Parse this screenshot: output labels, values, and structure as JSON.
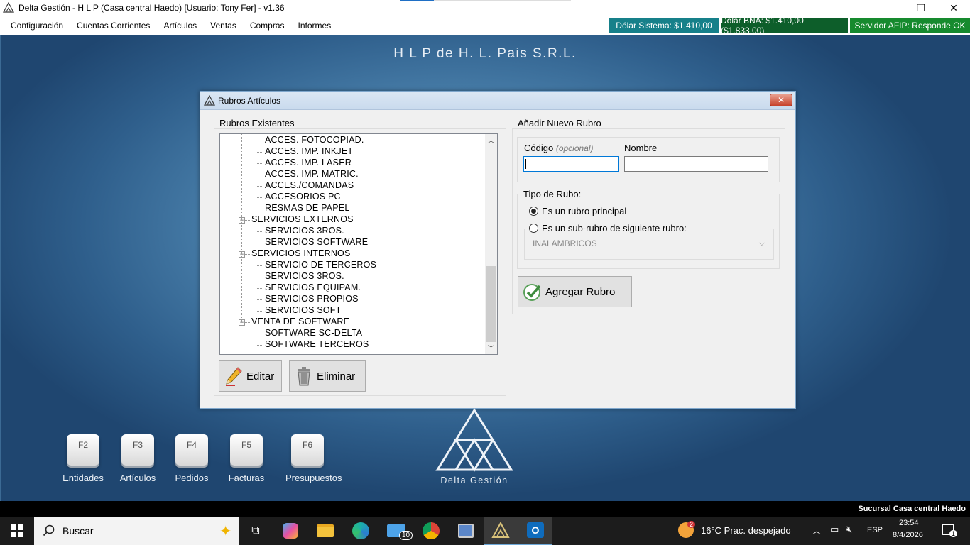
{
  "window": {
    "title": "Delta Gestión - H L P (Casa central Haedo) [Usuario: Tony Fer] - v1.36",
    "minimize": "—",
    "restore": "❐",
    "close": "✕"
  },
  "menu": [
    "Configuración",
    "Cuentas Corrientes",
    "Artículos",
    "Ventas",
    "Compras",
    "Informes"
  ],
  "status": {
    "dolar_sistema": "Dólar Sistema: $1.410,00",
    "dolar_bna": "Dólar BNA: $1.410,00 ($1.833,00)",
    "afip": "Servidor AFIP:  Responde OK",
    "colors": {
      "sistema": "#16808a",
      "bna": "#0d5e2a",
      "afip": "#168a2e"
    }
  },
  "company_name": "H L P de H. L. Pais S.R.L.",
  "dialog": {
    "title": "Rubros Artículos",
    "close_label": "✕",
    "existing": {
      "label": "Rubros Existentes",
      "tree": [
        {
          "label": "ACCES. FOTOCOPIAD.",
          "level": 2
        },
        {
          "label": "ACCES. IMP. INKJET",
          "level": 2
        },
        {
          "label": "ACCES. IMP. LASER",
          "level": 2
        },
        {
          "label": "ACCES. IMP. MATRIC.",
          "level": 2
        },
        {
          "label": "ACCES./COMANDAS",
          "level": 2
        },
        {
          "label": "ACCESORIOS PC",
          "level": 2
        },
        {
          "label": "RESMAS DE PAPEL",
          "level": 2
        },
        {
          "label": "SERVICIOS EXTERNOS",
          "level": 1,
          "expander": "−"
        },
        {
          "label": "SERVICIOS 3ROS.",
          "level": 2
        },
        {
          "label": "SERVICIOS SOFTWARE",
          "level": 2
        },
        {
          "label": "SERVICIOS INTERNOS",
          "level": 1,
          "expander": "−"
        },
        {
          "label": "SERVICIO DE TERCEROS",
          "level": 2
        },
        {
          "label": "SERVICIOS 3ROS.",
          "level": 2
        },
        {
          "label": "SERVICIOS EQUIPAM.",
          "level": 2
        },
        {
          "label": "SERVICIOS PROPIOS",
          "level": 2
        },
        {
          "label": "SERVICIOS SOFT",
          "level": 2
        },
        {
          "label": "VENTA DE SOFTWARE",
          "level": 1,
          "expander": "−"
        },
        {
          "label": "SOFTWARE SC-DELTA",
          "level": 2
        },
        {
          "label": "SOFTWARE TERCEROS",
          "level": 2
        }
      ],
      "scroll_up": "︿",
      "scroll_down": "﹀",
      "edit_label": "Editar",
      "delete_label": "Eliminar"
    },
    "new": {
      "label": "Añadir Nuevo Rubro",
      "code_label": "Código",
      "code_optional": "(opcional)",
      "code_value": "",
      "name_label": "Nombre",
      "name_value": "",
      "type_label": "Tipo de Rubo:",
      "radio_main": "Es un rubro principal",
      "radio_sub": "Es un sub-rubro de siguiente rubro:",
      "selected_radio": "main",
      "parent_select": "INALAMBRICOS",
      "add_label": "Agregar Rubro"
    }
  },
  "fkeys": [
    {
      "key": "F2",
      "label": "Entidades"
    },
    {
      "key": "F3",
      "label": "Artículos"
    },
    {
      "key": "F4",
      "label": "Pedidos"
    },
    {
      "key": "F5",
      "label": "Facturas"
    },
    {
      "key": "F6",
      "label": "Presupuestos"
    }
  ],
  "logo_text": "Delta Gestión",
  "sucursal": "Sucursal Casa central Haedo",
  "taskbar": {
    "search_placeholder": "Buscar",
    "mail_badge": "10",
    "weather": "16°C  Prac. despejado",
    "weather_badge": "2",
    "lang": "ESP",
    "time": "23:54",
    "date": "8/4/2026",
    "notif_count": "1"
  }
}
